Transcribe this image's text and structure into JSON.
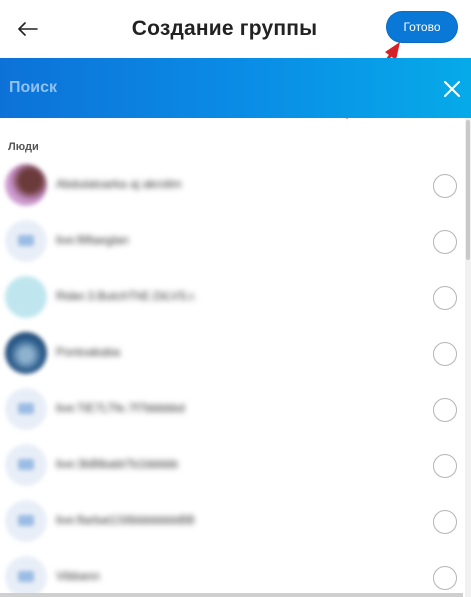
{
  "header": {
    "title": "Создание группы",
    "done_label": "Готово",
    "back_icon": "arrow-left-icon"
  },
  "search": {
    "placeholder": "Поиск",
    "value": "",
    "close_icon": "close-icon"
  },
  "section": {
    "label": "Люди"
  },
  "contacts": [
    {
      "name": "Abdulatoarka aj akrolim",
      "avatar_color": "#c792c9"
    },
    {
      "name": "live:fliftaeglan",
      "avatar_color": "#e8eef7"
    },
    {
      "name": "Rider.3.ButchThE.DiLVS.r.",
      "avatar_color": "#bfe6ee"
    },
    {
      "name": "Pontoakaba",
      "avatar_color": "#2f5f8f"
    },
    {
      "name": "live:TiE7LTfe.7f7bbbbbd",
      "avatar_color": "#e8eef7"
    },
    {
      "name": "live:3bBlbabt7b1bbbbb",
      "avatar_color": "#e8eef7"
    },
    {
      "name": "live:flarbat1S6bbbbbbbBB",
      "avatar_color": "#e8eef7"
    },
    {
      "name": "Vibbann",
      "avatar_color": "#e8eef7"
    }
  ],
  "colors": {
    "accent": "#0a78d7",
    "search_gradient_start": "#0d72d8",
    "search_gradient_end": "#06aae9",
    "annotation_arrow": "#d62128"
  }
}
